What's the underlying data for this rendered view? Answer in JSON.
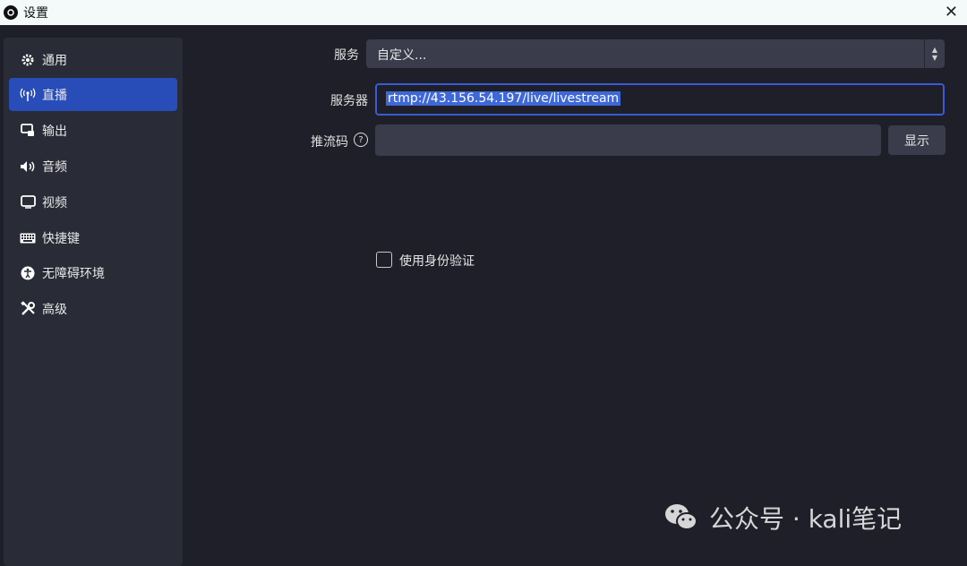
{
  "window": {
    "title": "设置",
    "close_icon": "✕"
  },
  "sidebar": {
    "items": [
      {
        "label": "通用",
        "icon": "gear-icon",
        "active": false
      },
      {
        "label": "直播",
        "icon": "broadcast-icon",
        "active": true
      },
      {
        "label": "输出",
        "icon": "output-icon",
        "active": false
      },
      {
        "label": "音频",
        "icon": "speaker-icon",
        "active": false
      },
      {
        "label": "视频",
        "icon": "monitor-icon",
        "active": false
      },
      {
        "label": "快捷键",
        "icon": "keyboard-icon",
        "active": false
      },
      {
        "label": "无障碍环境",
        "icon": "accessibility-icon",
        "active": false
      },
      {
        "label": "高级",
        "icon": "tools-icon",
        "active": false
      }
    ]
  },
  "form": {
    "service_label": "服务",
    "service_value": "自定义...",
    "server_label": "服务器",
    "server_value": "rtmp://43.156.54.197/live/livestream",
    "stream_key_label": "推流码",
    "stream_key_value": "",
    "show_button": "显示",
    "auth_checkbox_label": "使用身份验证",
    "auth_checked": false
  },
  "watermark": {
    "text": "公众号 · kali笔记"
  },
  "colors": {
    "accent": "#284cb8",
    "background": "#1e1f29",
    "panel": "#292b36",
    "input": "#3a3c4b"
  }
}
